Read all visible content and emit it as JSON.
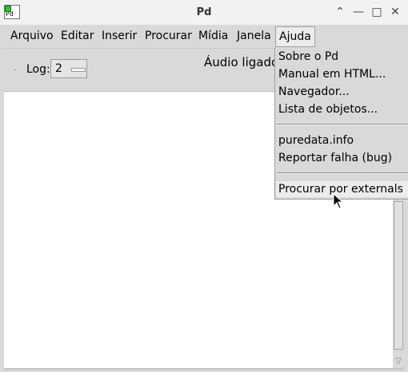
{
  "window": {
    "title": "Pd",
    "icon_text": "Pd"
  },
  "window_controls": {
    "collapse": "⌃",
    "minimize": "—",
    "maximize": "□",
    "close": "✕"
  },
  "menubar": {
    "items": [
      {
        "label": "Arquivo"
      },
      {
        "label": "Editar"
      },
      {
        "label": "Inserir"
      },
      {
        "label": "Procurar"
      },
      {
        "label": "Mídia"
      },
      {
        "label": "Janela"
      },
      {
        "label": "Ajuda"
      }
    ]
  },
  "toolbar": {
    "log_label": "Log:",
    "log_value": "2",
    "audio_status": "Áudio ligado"
  },
  "help_menu": {
    "items": [
      {
        "label": "Sobre o Pd"
      },
      {
        "label": "Manual em HTML..."
      },
      {
        "label": "Navegador..."
      },
      {
        "label": "Lista de objetos..."
      },
      {
        "label": "puredata.info"
      },
      {
        "label": "Reportar falha (bug)"
      },
      {
        "label": "Procurar por externals"
      }
    ]
  }
}
